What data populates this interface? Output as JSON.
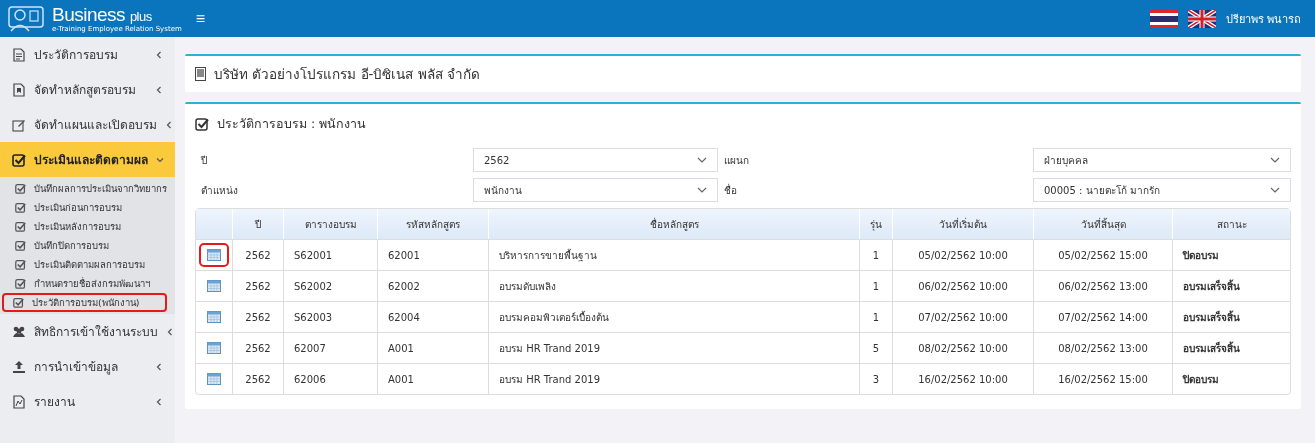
{
  "header": {
    "brand": "Business",
    "brand_suffix": "plus",
    "tagline": "e-Training Employee Relation System",
    "menu_glyph": "≡",
    "user": "ปรียาพร พนารถ"
  },
  "sidebar": {
    "items": [
      {
        "kind": "doc",
        "label": "ประวัติการอบรม",
        "expanded": false,
        "selected": false
      },
      {
        "kind": "book",
        "label": "จัดทำหลักสูตรอบรม",
        "expanded": false,
        "selected": false
      },
      {
        "kind": "edit",
        "label": "จัดทำแผนและเปิดอบรม",
        "expanded": false,
        "selected": false
      },
      {
        "kind": "check",
        "label": "ประเมินและติดตามผล",
        "expanded": true,
        "selected": true,
        "children": [
          {
            "label": "บันทึกผลการประเมินจากวิทยากร",
            "highlighted": false
          },
          {
            "label": "ประเมินก่อนการอบรม",
            "highlighted": false
          },
          {
            "label": "ประเมินหลังการอบรม",
            "highlighted": false
          },
          {
            "label": "บันทึกปิดการอบรม",
            "highlighted": false
          },
          {
            "label": "ประเมินติดตามผลการอบรม",
            "highlighted": false
          },
          {
            "label": "กำหนดรายชื่อส่งกรมพัฒนาฯ",
            "highlighted": false
          },
          {
            "label": "ประวัติการอบรม(พนักงาน)",
            "highlighted": true
          }
        ]
      },
      {
        "kind": "users",
        "label": "สิทธิการเข้าใช้งานระบบ",
        "expanded": false,
        "selected": false
      },
      {
        "kind": "upload",
        "label": "การนำเข้าข้อมูล",
        "expanded": false,
        "selected": false
      },
      {
        "kind": "report",
        "label": "รายงาน",
        "expanded": false,
        "selected": false
      }
    ]
  },
  "company": {
    "title": "บริษัท ตัวอย่างโปรแกรม อี-บิซิเนส พลัส จำกัด"
  },
  "panel": {
    "title": "ประวัติการอบรม : พนักงาน",
    "filters": [
      {
        "label": "ปี",
        "value": "2562"
      },
      {
        "label": "แผนก",
        "value": "ฝ่ายบุคคล"
      },
      {
        "label": "ตำแหน่ง",
        "value": "พนักงาน"
      },
      {
        "label": "ชื่อ",
        "value": "00005 : นายตะโก้ มากรัก"
      }
    ],
    "table": {
      "columns": [
        "ปี",
        "ตารางอบรม",
        "รหัสหลักสูตร",
        "ชื่อหลักสูตร",
        "รุ่น",
        "วันที่เริ่มต้น",
        "วันที่สิ้นสุด",
        "สถานะ"
      ],
      "rows": [
        {
          "highlighted": true,
          "cells": [
            "2562",
            "S62001",
            "62001",
            "บริหารการขายพื้นฐาน",
            "1",
            "05/02/2562 10:00",
            "05/02/2562 15:00",
            "ปิดอบรม"
          ]
        },
        {
          "highlighted": false,
          "cells": [
            "2562",
            "S62002",
            "62002",
            "อบรมดับเพลิง",
            "1",
            "06/02/2562 10:00",
            "06/02/2562 13:00",
            "อบรมเสร็จสิ้น"
          ]
        },
        {
          "highlighted": false,
          "cells": [
            "2562",
            "S62003",
            "62004",
            "อบรมคอมพิวเตอร์เบื้องต้น",
            "1",
            "07/02/2562 10:00",
            "07/02/2562 14:00",
            "อบรมเสร็จสิ้น"
          ]
        },
        {
          "highlighted": false,
          "cells": [
            "2562",
            "62007",
            "A001",
            "อบรม HR Trand 2019",
            "5",
            "08/02/2562 10:00",
            "08/02/2562 13:00",
            "อบรมเสร็จสิ้น"
          ]
        },
        {
          "highlighted": false,
          "cells": [
            "2562",
            "62006",
            "A001",
            "อบรม HR Trand 2019",
            "3",
            "16/02/2562 10:00",
            "16/02/2562 15:00",
            "ปิดอบรม"
          ]
        }
      ]
    }
  }
}
